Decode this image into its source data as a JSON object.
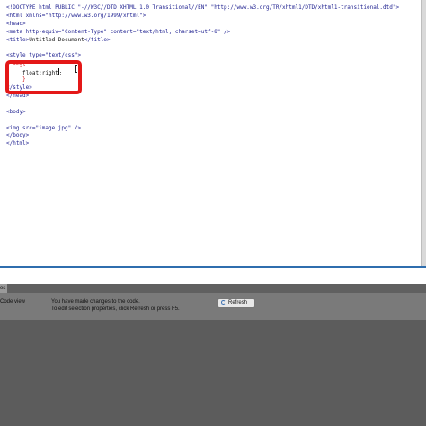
{
  "editor": {
    "lines": [
      [
        {
          "text": "<!DOCTYPE html PUBLIC \"-//W3C//DTD XHTML 1.0 Transitional//EN\" \"http://www.w3.org/TR/xhtml1/DTD/xhtml1-transitional.dtd\">",
          "color": "blue"
        }
      ],
      [
        {
          "text": "<html xmlns=\"http://www.w3.org/1999/xhtml\">",
          "color": "blue"
        }
      ],
      [
        {
          "text": "<head>",
          "color": "blue"
        }
      ],
      [
        {
          "text": "<meta http-equiv=\"Content-Type\" content=\"text/html; charset=utf-8\" />",
          "color": "blue"
        }
      ],
      [
        {
          "text": "<title>",
          "color": "blue"
        },
        {
          "text": "Untitled Document",
          "color": "black"
        },
        {
          "text": "</title>",
          "color": "blue"
        }
      ],
      [
        {
          "text": "",
          "color": "blue"
        }
      ],
      [
        {
          "text": "<style type=\"text/css\">",
          "color": "blue"
        }
      ],
      [
        {
          "text": "  img{",
          "color": "red"
        }
      ],
      [
        {
          "text": "     float:right",
          "color": "black"
        },
        {
          "text": ";",
          "color": "black"
        }
      ],
      [
        {
          "text": "     }",
          "color": "red"
        }
      ],
      [
        {
          "text": "</style>",
          "color": "blue"
        }
      ],
      [
        {
          "text": "</head>",
          "color": "blue"
        }
      ],
      [
        {
          "text": "",
          "color": "blue"
        }
      ],
      [
        {
          "text": "<body>",
          "color": "blue"
        }
      ],
      [
        {
          "text": "",
          "color": "blue"
        }
      ],
      [
        {
          "text": "<img src=\"image.jpg\" />",
          "color": "blue"
        }
      ],
      [
        {
          "text": "</body>",
          "color": "blue"
        }
      ],
      [
        {
          "text": "</html>",
          "color": "blue"
        }
      ]
    ]
  },
  "panel": {
    "tab_label": "es"
  },
  "properties": {
    "code_view_label": "Code view",
    "message_line1": "You have made changes to the code.",
    "message_line2": "To edit selection properties, click Refresh or press F5.",
    "refresh_label": "Refresh"
  },
  "colors": {
    "blue": "#1d1f8f",
    "red": "#d61f1f",
    "black": "#111111",
    "highlight": "#e41818",
    "panel_bg": "#5c5c5c"
  },
  "icons": {
    "refresh": "refresh-icon",
    "cursor": "text-cursor-icon"
  }
}
